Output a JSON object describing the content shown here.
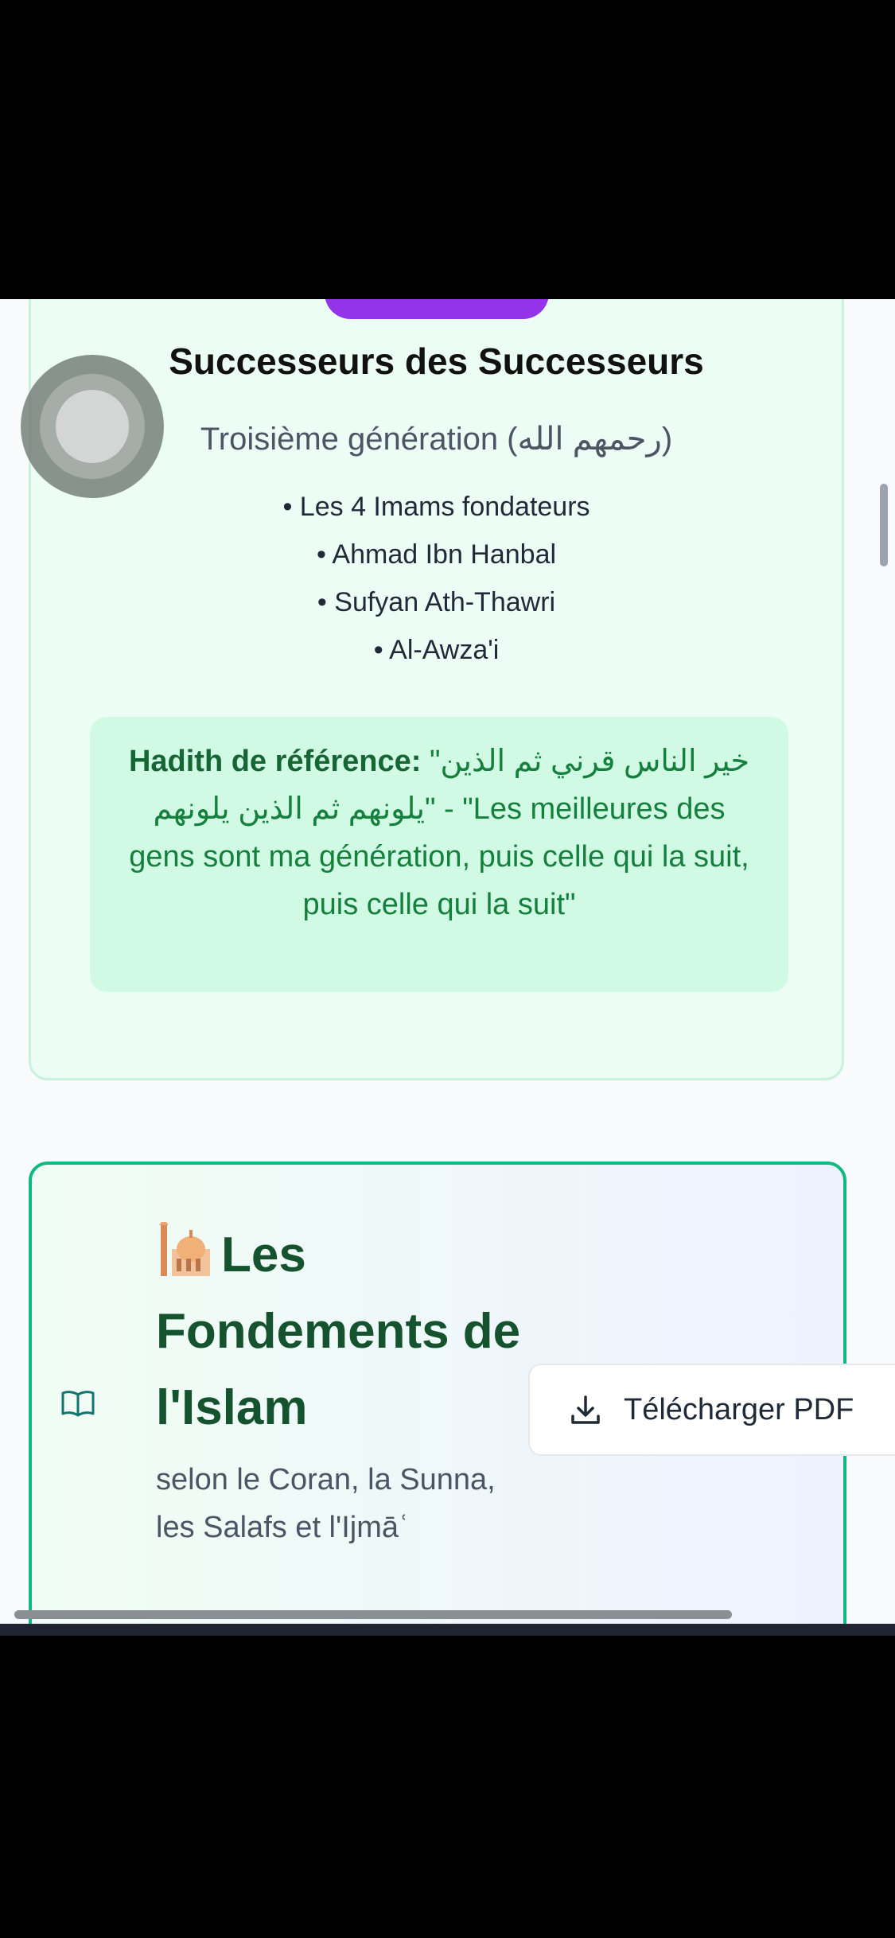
{
  "generation_card": {
    "title": "Successeurs des Successeurs",
    "subtitle": "Troisième génération (رحمهم الله)",
    "items": [
      "• Les 4 Imams fondateurs",
      "• Ahmad Ibn Hanbal",
      "• Sufyan Ath-Thawri",
      "• Al-Awza'i"
    ],
    "hadith_label": "Hadith de référence:",
    "hadith_text": "\"خير الناس قرني ثم الذين يلونهم ثم الذين يلونهم\" - \"Les meilleures des gens sont ma génération, puis celle qui la suit, puis celle qui la suit\""
  },
  "fondements_card": {
    "title": "Les Fondements de l'Islam",
    "subtitle": "selon le Coran, la Sunna, les Salafs et l'Ijmāʿ",
    "download_label": "Télécharger PDF"
  },
  "colors": {
    "accent_green": "#10b981",
    "title_green": "#14532d",
    "hadith_green": "#15803d",
    "pill_purple": "#9333ea"
  },
  "icons": [
    "mosque-icon",
    "book-open-icon",
    "download-icon"
  ]
}
